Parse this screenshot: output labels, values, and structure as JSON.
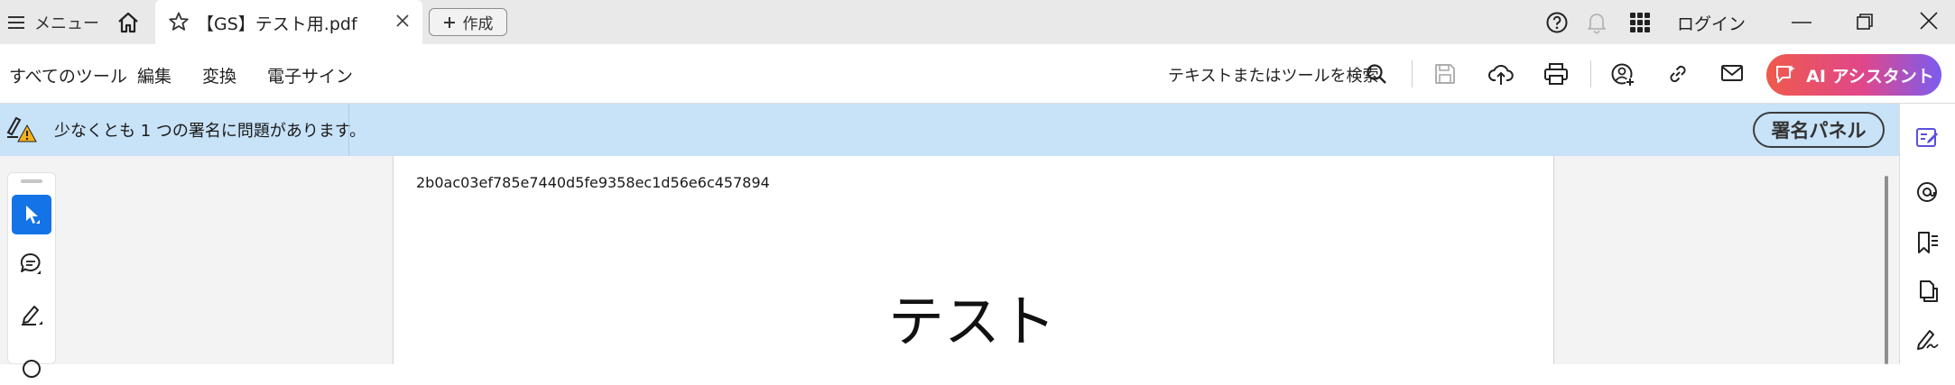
{
  "titlebar": {
    "menu_label": "メニュー",
    "tab_title": "【GS】テスト用.pdf",
    "new_button_label": "作成",
    "login_label": "ログイン"
  },
  "toolbar": {
    "menu_items": [
      "すべてのツール",
      "編集",
      "変換",
      "電子サイン"
    ],
    "search_label": "テキストまたはツールを検索",
    "ai_button_label": "AI アシスタント"
  },
  "banner": {
    "message": "少なくとも 1 つの署名に問題があります。",
    "panel_button_label": "署名パネル"
  },
  "document": {
    "hash_text": "2b0ac03ef785e7440d5fe9358ec1d56e6c457894",
    "heading": "テスト"
  },
  "icons": {
    "titlebar": [
      "hamburger-menu-icon",
      "home-icon",
      "star-icon",
      "close-tab-icon",
      "plus-icon",
      "help-icon",
      "bell-icon",
      "apps-grid-icon",
      "minimize-icon",
      "restore-icon",
      "window-close-icon"
    ],
    "toolbar": [
      "search-icon",
      "save-icon",
      "upload-cloud-icon",
      "print-icon",
      "share-user-icon",
      "link-icon",
      "mail-icon",
      "ai-assistant-icon"
    ],
    "left_tools": [
      "select-cursor-icon",
      "comment-icon",
      "highlight-pen-icon"
    ],
    "right_rail": [
      "edit-panel-icon",
      "comments-icon",
      "bookmarks-icon",
      "pages-icon",
      "signature-icon"
    ]
  },
  "colors": {
    "accent_blue": "#1473e6",
    "banner_bg": "#c8e2f8",
    "ai_gradient_start": "#ef5a4c",
    "ai_gradient_end": "#7a5cf0",
    "right_rail_active": "#5b4fe0"
  }
}
